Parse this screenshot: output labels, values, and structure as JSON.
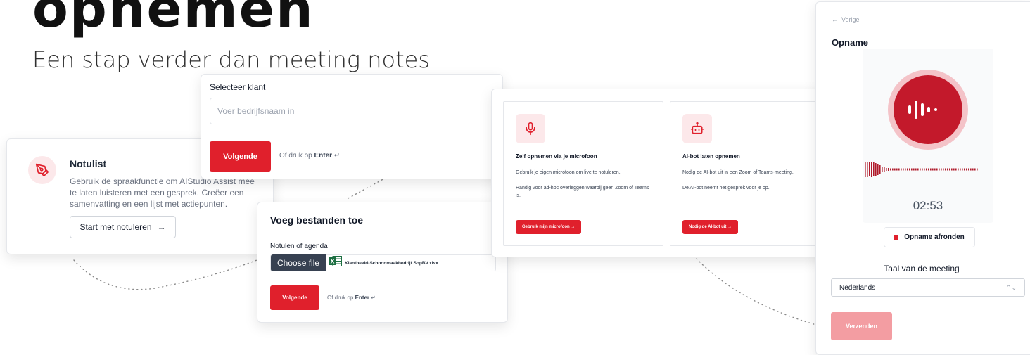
{
  "hero": {
    "title": "opnemen",
    "subtitle": "Een stap verder dan meeting notes"
  },
  "notulist": {
    "icon": "pen-icon",
    "title": "Notulist",
    "description": "Gebruik de spraakfunctie om AIStudio Assist mee te laten luisteren met een gesprek. Creëer een samenvatting en een lijst met actiepunten.",
    "button_label": "Start met notuleren",
    "button_icon": "arrow-right-icon"
  },
  "select_client": {
    "label": "Selecteer klant",
    "placeholder": "Voer bedrijfsnaam in",
    "next_label": "Volgende",
    "hint_prefix": "Of druk op",
    "hint_key": "Enter"
  },
  "add_files": {
    "title": "Voeg bestanden toe",
    "field_label": "Notulen of agenda",
    "choose_label": "Choose file",
    "file_name": "Klantbeeld-Schoonmaakbedrijf SopBV.xlsx",
    "next_label": "Volgende",
    "hint_prefix": "Of druk op",
    "hint_key": "Enter"
  },
  "record_options": {
    "microphone": {
      "icon": "microphone-icon",
      "title": "Zelf opnemen via je microfoon",
      "line1": "Gebruik je eigen microfoon om live te notuleren.",
      "line2": "Handig voor ad-hoc overleggen waarbij geen Zoom of Teams is.",
      "button_label": "Gebruik mijn microfoon →"
    },
    "bot": {
      "icon": "robot-icon",
      "title": "AI-bot laten opnemen",
      "line1": "Nodig de AI-bot uit in een Zoom of Teams-meeting.",
      "line2": "De AI-bot neemt het gesprek voor je op.",
      "button_label": "Nodig de AI-bot uit →"
    }
  },
  "recording_panel": {
    "back_label": "Vorige",
    "title": "Opname",
    "timer": "02:53",
    "stop_label": "Opname afronden",
    "language_label": "Taal van de meeting",
    "language_value": "Nederlands",
    "submit_label": "Verzenden"
  },
  "colors": {
    "accent": "#e0202c",
    "record": "#c3192b",
    "accent_soft": "#fce8ea",
    "disabled": "#f39da2"
  }
}
